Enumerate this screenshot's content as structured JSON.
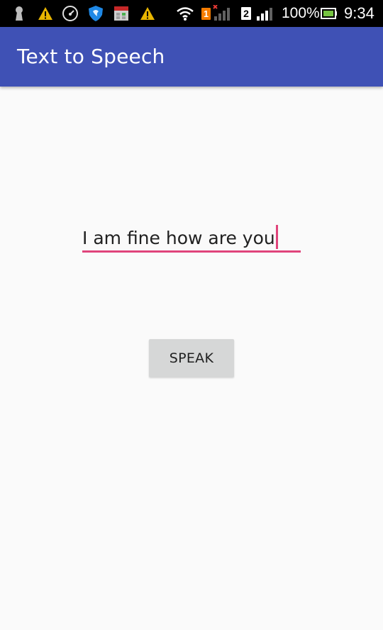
{
  "status_bar": {
    "battery_percent": "100%",
    "time": "9:34",
    "sim1_label": "1",
    "sim2_label": "2",
    "icons": [
      "keyhole-icon",
      "warning-icon",
      "speedometer-icon",
      "shield-icon",
      "calendar-icon",
      "warning-icon",
      "wifi-icon",
      "sim1-signal-icon",
      "sim2-signal-icon",
      "battery-icon"
    ]
  },
  "app_bar": {
    "title": "Text to Speech",
    "color": "#3f51b5"
  },
  "input": {
    "value": "I am fine how are you",
    "accent_color": "#e0447b"
  },
  "speak_button": {
    "label": "SPEAK"
  }
}
